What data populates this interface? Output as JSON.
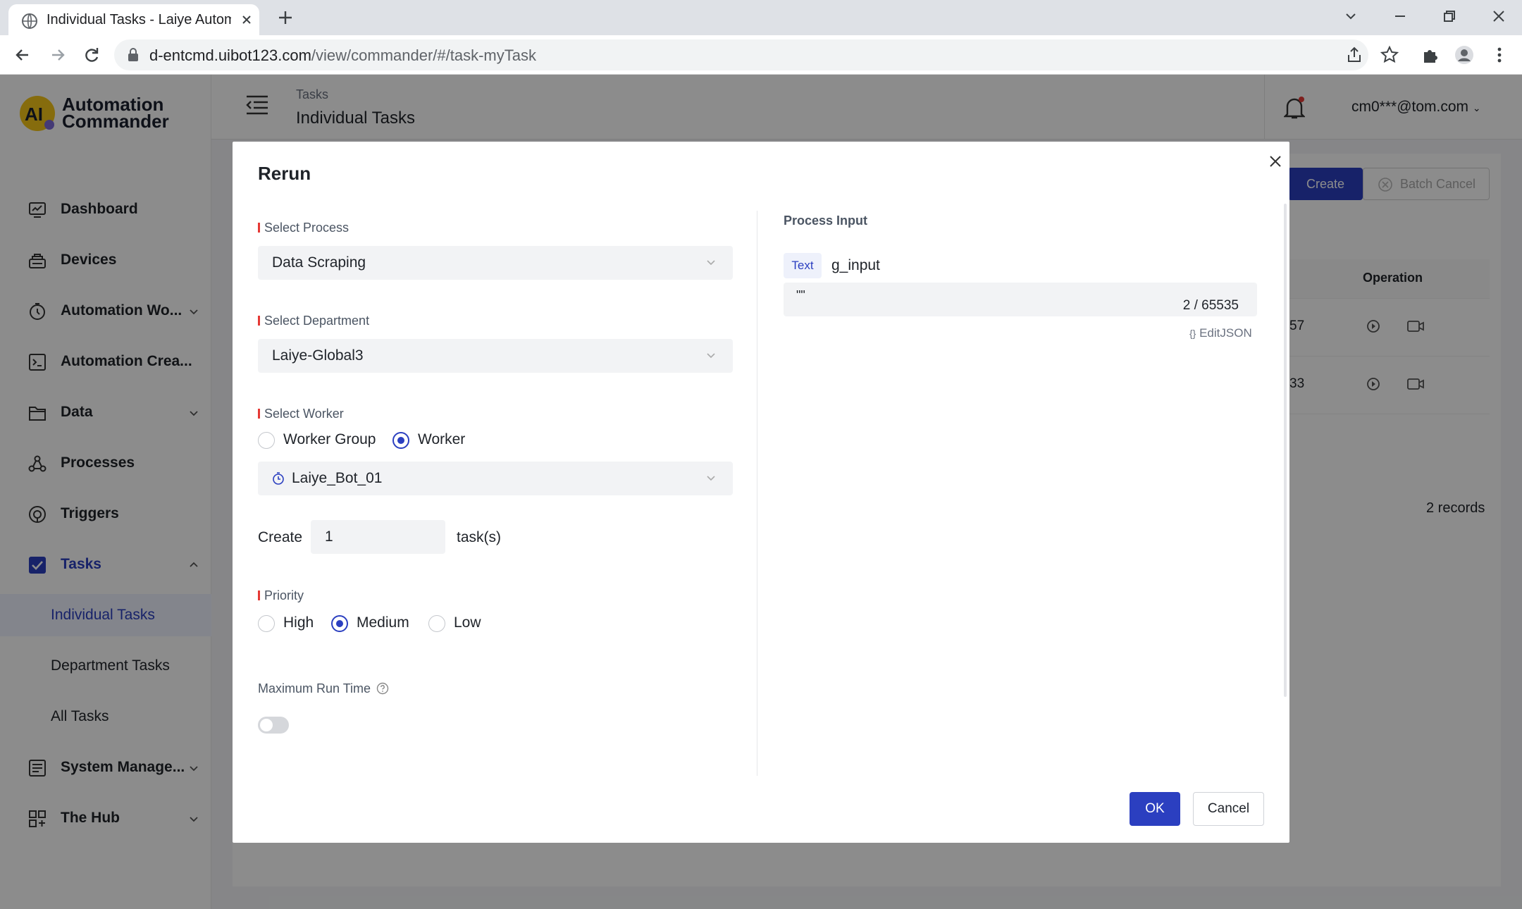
{
  "browser": {
    "tab_title": "Individual Tasks - Laiye Autom",
    "url_host": "d-entcmd.uibot123.com",
    "url_path": "/view/commander/#/task-myTask"
  },
  "app": {
    "logo_line1": "Automation",
    "logo_line2": "Commander",
    "logo_mark": "AI"
  },
  "sidebar": {
    "items": [
      {
        "label": "Dashboard",
        "icon": "dashboard-icon"
      },
      {
        "label": "Devices",
        "icon": "devices-icon"
      },
      {
        "label": "Automation Wo...",
        "icon": "workflow-icon",
        "expandable": true
      },
      {
        "label": "Automation Crea...",
        "icon": "creator-icon"
      },
      {
        "label": "Data",
        "icon": "folder-icon",
        "expandable": true
      },
      {
        "label": "Processes",
        "icon": "processes-icon"
      },
      {
        "label": "Triggers",
        "icon": "triggers-icon"
      },
      {
        "label": "Tasks",
        "icon": "tasks-icon",
        "expanded": true
      },
      {
        "label": "System Manage...",
        "icon": "system-icon",
        "expandable": true
      },
      {
        "label": "The Hub",
        "icon": "hub-icon",
        "expandable": true
      }
    ],
    "tasks_sub": [
      "Individual Tasks",
      "Department Tasks",
      "All Tasks"
    ]
  },
  "header": {
    "breadcrumb": "Tasks",
    "title": "Individual Tasks",
    "user": "cm0***@tom.com"
  },
  "page": {
    "create_label": "Create",
    "batch_cancel_label": "Batch Cancel",
    "operation_header": "Operation",
    "row_cells": [
      "57",
      "33"
    ],
    "records": "2 records"
  },
  "modal": {
    "title": "Rerun",
    "select_process_label": "Select Process",
    "process_value": "Data Scraping",
    "select_department_label": "Select Department",
    "department_value": "Laiye-Global3",
    "select_worker_label": "Select Worker",
    "worker_group_label": "Worker Group",
    "worker_label": "Worker",
    "worker_value": "Laiye_Bot_01",
    "create_label": "Create",
    "create_value": "1",
    "tasks_suffix": "task(s)",
    "priority_label": "Priority",
    "priority_high": "High",
    "priority_medium": "Medium",
    "priority_low": "Low",
    "max_run_time_label": "Maximum Run Time",
    "process_input_title": "Process Input",
    "input_type_tag": "Text",
    "input_name": "g_input",
    "input_value": "\"\"",
    "input_count": "2 / 65535",
    "edit_json_label": "EditJSON",
    "ok_label": "OK",
    "cancel_label": "Cancel"
  },
  "colors": {
    "primary": "#2b3fc0",
    "required": "#e53935",
    "overlay": "rgba(0,0,0,0.45)"
  }
}
